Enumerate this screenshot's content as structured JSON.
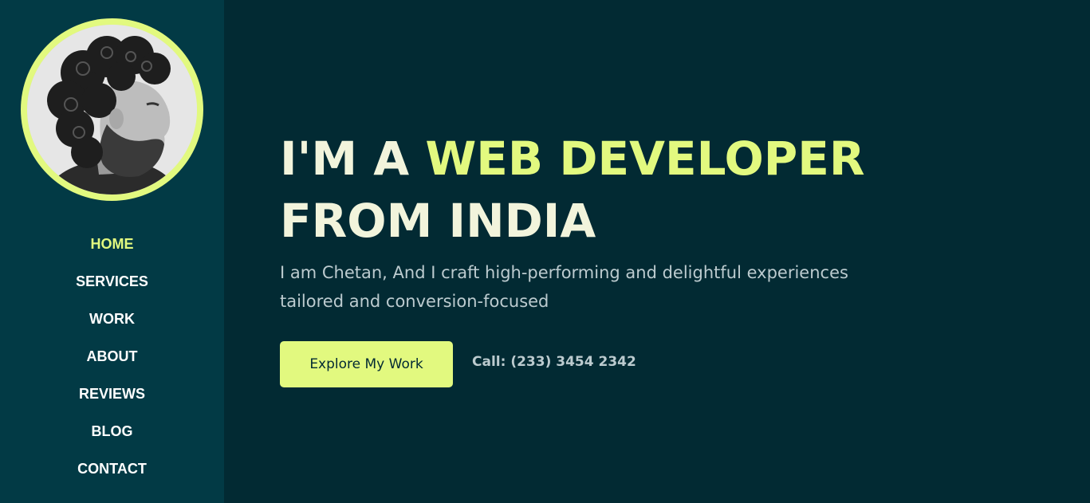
{
  "sidebar": {
    "avatar_alt": "Chetan portrait",
    "nav": [
      {
        "label": "HOME",
        "active": true
      },
      {
        "label": "SERVICES",
        "active": false
      },
      {
        "label": "WORK",
        "active": false
      },
      {
        "label": "ABOUT",
        "active": false
      },
      {
        "label": "REVIEWS",
        "active": false
      },
      {
        "label": "BLOG",
        "active": false
      },
      {
        "label": "CONTACT",
        "active": false
      }
    ]
  },
  "hero": {
    "title_prefix": "I'M A ",
    "title_accent": "WEB DEVELOPER",
    "title_suffix": "FROM INDIA",
    "description": "I am Chetan, And I craft high-performing and delightful experiences tailored and conversion-focused",
    "cta_label": "Explore My Work",
    "call_text": "Call: (233) 3454 2342"
  },
  "colors": {
    "accent": "#e2f97f",
    "background": "#022a33",
    "sidebar": "#023a45",
    "heading": "#f2f4dc",
    "body_text": "#bccbcf"
  }
}
